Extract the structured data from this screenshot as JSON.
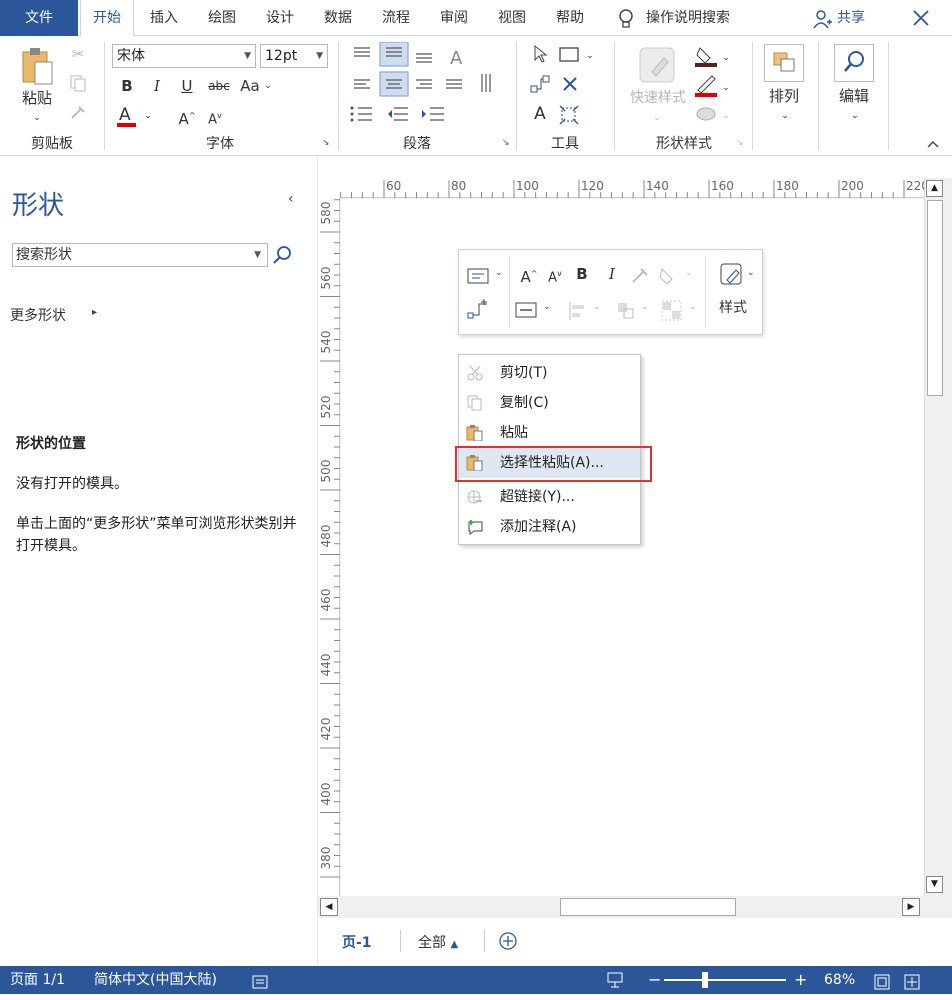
{
  "tabs": {
    "file": "文件",
    "home": "开始",
    "insert": "插入",
    "draw": "绘图",
    "design": "设计",
    "data": "数据",
    "process": "流程",
    "review": "审阅",
    "view": "视图",
    "help": "帮助",
    "tellme": "操作说明搜索",
    "share": "共享"
  },
  "ribbon": {
    "clipboard": {
      "paste": "粘贴",
      "label": "剪贴板"
    },
    "font": {
      "name": "宋体",
      "size": "12pt",
      "bold": "B",
      "italic": "I",
      "underline": "U",
      "strike": "abc",
      "case": "Aa",
      "label": "字体"
    },
    "paragraph": {
      "label": "段落"
    },
    "tools": {
      "label": "工具",
      "text": "A"
    },
    "shape_styles": {
      "quick": "快速样式",
      "label": "形状样式"
    },
    "arrange": {
      "label": "排列"
    },
    "edit": {
      "label": "编辑"
    }
  },
  "shapes_panel": {
    "title": "形状",
    "search_placeholder": "搜索形状",
    "more_shapes": "更多形状",
    "location_title": "形状的位置",
    "no_stencil": "没有打开的模具。",
    "hint": "单击上面的“更多形状”菜单可浏览形状类别并打开模具。"
  },
  "ruler": {
    "top": [
      "60",
      "80",
      "100",
      "120",
      "140",
      "160",
      "180",
      "200",
      "220"
    ],
    "left": [
      "580",
      "560",
      "540",
      "520",
      "500",
      "480",
      "460",
      "440",
      "420",
      "400",
      "380"
    ]
  },
  "mini_toolbar": {
    "bold": "B",
    "italic": "I",
    "style": "样式"
  },
  "context_menu": [
    {
      "label": "剪切(T)",
      "enabled": false
    },
    {
      "label": "复制(C)",
      "enabled": false
    },
    {
      "label": "粘贴",
      "enabled": true
    },
    {
      "label": "选择性粘贴(A)...",
      "enabled": true,
      "highlighted": true
    },
    {
      "label": "超链接(Y)...",
      "enabled": false
    },
    {
      "label": "添加注释(A)",
      "enabled": true
    }
  ],
  "page_tabs": {
    "current": "页-1",
    "all": "全部"
  },
  "status": {
    "page": "页面 1/1",
    "language": "简体中文(中国大陆)",
    "zoom": "68%"
  },
  "colors": {
    "accent": "#2b579a",
    "highlight_box": "#e23030",
    "font_color_bar": "#e00000"
  }
}
